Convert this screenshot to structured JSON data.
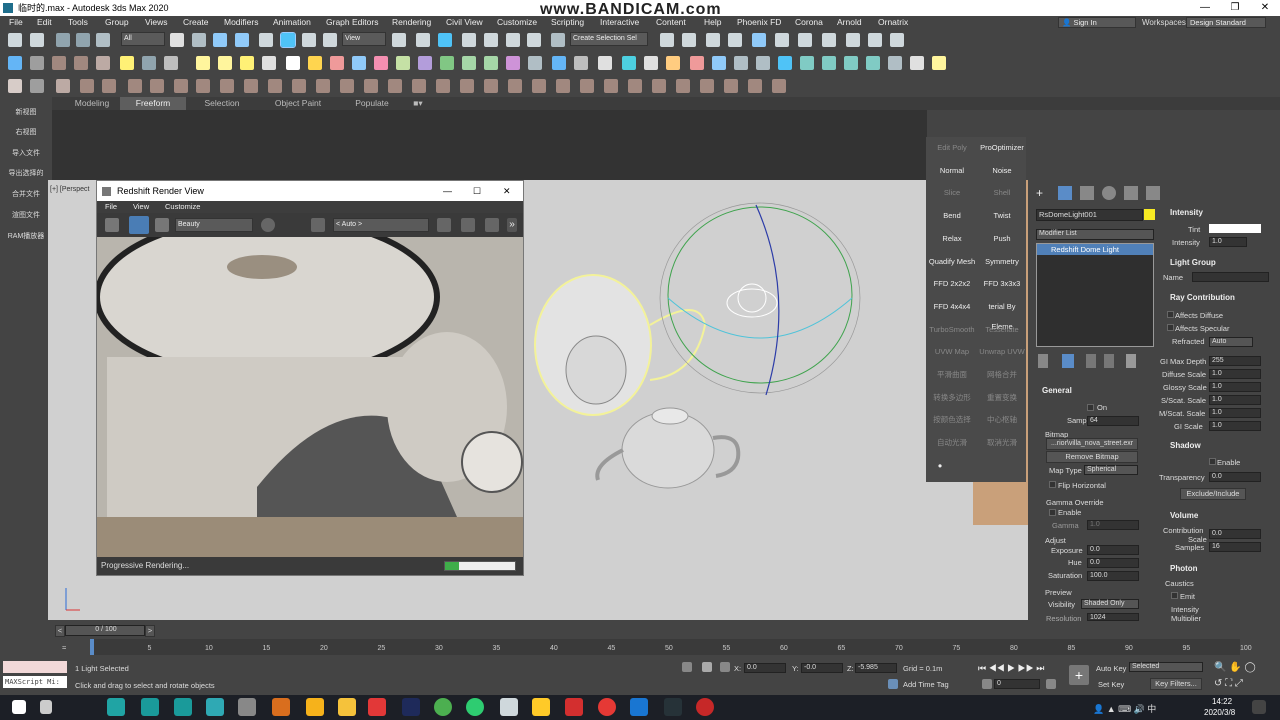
{
  "window": {
    "title": "临时的.max - Autodesk 3ds Max 2020",
    "watermark": "www.BANDICAM.com"
  },
  "menubar": {
    "items": [
      "File",
      "Edit",
      "Tools",
      "Group",
      "Views",
      "Create",
      "Modifiers",
      "Animation",
      "Graph Editors",
      "Rendering",
      "Civil View",
      "Customize",
      "Scripting",
      "Interactive",
      "Content",
      "Help",
      "Phoenix FD",
      "Corona",
      "Arnold",
      "Ornatrix"
    ],
    "sign_in": "Sign In",
    "workspaces_label": "Workspaces:",
    "workspace_value": "Design Standard"
  },
  "toolbar": {
    "filter_value": "All",
    "ref_coord": "View",
    "selection_set": "Create Selection Sel"
  },
  "ribbon": {
    "tabs": [
      "Modeling",
      "Freeform",
      "Selection",
      "Object Paint",
      "Populate"
    ],
    "active": "Freeform"
  },
  "left_panel": {
    "items": [
      "新视图",
      "右视图",
      "导入文件",
      "导出选择的",
      "合并文件",
      "渲图文件",
      "RAM播放器"
    ]
  },
  "viewport": {
    "label": "[+] [Perspect"
  },
  "render_view": {
    "title": "Redshift Render View",
    "menu": [
      "File",
      "View",
      "Customize"
    ],
    "aov": "Beauty",
    "camera": "< Auto >",
    "status": "Progressive Rendering...",
    "progress": 0.2
  },
  "modifier_buttons": [
    [
      "Edit Poly",
      "ProOptimizer"
    ],
    [
      "Normal",
      "Noise"
    ],
    [
      "Slice",
      "Shell"
    ],
    [
      "Bend",
      "Twist"
    ],
    [
      "Relax",
      "Push"
    ],
    [
      "Quadify Mesh",
      "Symmetry"
    ],
    [
      "FFD 2x2x2",
      "FFD 3x3x3"
    ],
    [
      "FFD 4x4x4",
      "terial By Eleme"
    ],
    [
      "TurboSmooth",
      "Tessellate"
    ],
    [
      "UVW Map",
      "Unwrap UVW"
    ],
    [
      "平滑曲面",
      "网格合并"
    ],
    [
      "转换多边形",
      "重置变换"
    ],
    [
      "按颜色选择",
      "中心枢轴"
    ],
    [
      "自动光滑",
      "取消光滑"
    ]
  ],
  "command_panel": {
    "object_name": "RsDomeLight001",
    "modifier_list": "Modifier List",
    "stack_item": "Redshift Dome Light",
    "general": {
      "header": "General",
      "on_label": "On",
      "samples_label": "Samples",
      "samples": "64",
      "bitmap_label": "Bitmap",
      "bitmap_path": "...rior\\villa_nova_street.exr",
      "remove_bitmap": "Remove Bitmap",
      "map_type_label": "Map Type",
      "map_type": "Spherical",
      "flip_horizontal": "Flip Horizontal",
      "gamma_override": "Gamma Override",
      "enable_label": "Enable",
      "gamma_label": "Gamma",
      "gamma": "1.0",
      "adjust_label": "Adjust",
      "exposure_label": "Exposure",
      "exposure": "0.0",
      "hue_label": "Hue",
      "hue": "0.0",
      "saturation_label": "Saturation",
      "saturation": "100.0",
      "preview_label": "Preview",
      "visibility_label": "Visibility",
      "visibility": "Shaded Only",
      "resolution_label": "Resolution",
      "resolution": "1024"
    },
    "intensity": {
      "header": "Intensity",
      "tint_label": "Tint",
      "intensity_label": "Intensity",
      "intensity": "1.0"
    },
    "light_group": {
      "header": "Light Group",
      "name_label": "Name"
    },
    "ray_contribution": {
      "header": "Ray Contribution",
      "affects_diffuse": "Affects Diffuse",
      "affects_specular": "Affects Specular",
      "refracted_label": "Refracted",
      "refracted": "Auto",
      "gi_max_depth_label": "GI Max Depth",
      "gi_max_depth": "255",
      "diffuse_scale_label": "Diffuse Scale",
      "diffuse_scale": "1.0",
      "glossy_scale_label": "Glossy Scale",
      "glossy_scale": "1.0",
      "sscat_scale_label": "S/Scat. Scale",
      "sscat_scale": "1.0",
      "mscat_scale_label": "M/Scat. Scale",
      "mscat_scale": "1.0",
      "gi_scale_label": "GI Scale",
      "gi_scale": "1.0"
    },
    "shadow": {
      "header": "Shadow",
      "enable_label": "Enable",
      "transparency_label": "Transparency",
      "transparency": "0.0",
      "exclude_include": "Exclude/Include"
    },
    "volume": {
      "header": "Volume",
      "contribution_label": "Contribution",
      "scale_label": "Scale",
      "contribution": "0.0",
      "samples_label": "Samples",
      "samples": "16"
    },
    "photon": {
      "header": "Photon",
      "caustics_label": "Caustics",
      "emit_label": "Emit",
      "intensity_label": "Intensity",
      "multiplier_label": "Multiplier"
    }
  },
  "timeline": {
    "frame_display": "0 / 100",
    "ticks": [
      "0",
      "5",
      "10",
      "15",
      "20",
      "25",
      "30",
      "35",
      "40",
      "45",
      "50",
      "55",
      "60",
      "65",
      "70",
      "75",
      "80",
      "85",
      "90",
      "95",
      "100"
    ]
  },
  "statusbar": {
    "script_label": "MAXScript Mi:",
    "selection": "1 Light Selected",
    "prompt": "Click and drag to select and rotate objects",
    "x_label": "X:",
    "x": "0.0",
    "y_label": "Y:",
    "y": "-0.0",
    "z_label": "Z:",
    "z": "-5.985",
    "grid": "Grid = 0.1m",
    "add_time_tag": "Add Time Tag",
    "frame": "0",
    "auto_key": "Auto Key",
    "set_key": "Set Key",
    "selected": "Selected",
    "key_filters": "Key Filters..."
  },
  "taskbar": {
    "time": "14:22",
    "date": "2020/3/8"
  }
}
